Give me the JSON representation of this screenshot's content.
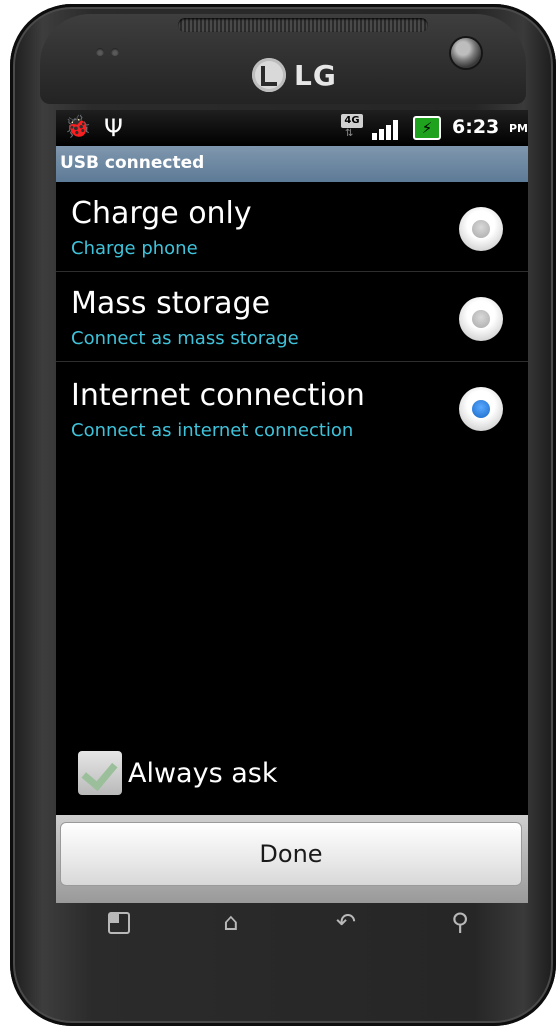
{
  "device": {
    "brand": "LG"
  },
  "status_bar": {
    "network_badge": "4G",
    "time": "6:23",
    "ampm": "PM",
    "icons": [
      "debug-bug-icon",
      "usb-icon",
      "4g-data-icon",
      "signal-icon",
      "battery-charging-icon"
    ]
  },
  "dialog": {
    "title": "USB connected",
    "options": [
      {
        "title": "Charge only",
        "subtitle": "Charge phone",
        "selected": false
      },
      {
        "title": "Mass storage",
        "subtitle": "Connect as mass storage",
        "selected": false
      },
      {
        "title": "Internet connection",
        "subtitle": "Connect as internet connection",
        "selected": true
      }
    ],
    "always_ask": {
      "label": "Always ask",
      "checked": true
    },
    "done_label": "Done"
  },
  "soft_keys": [
    "menu-icon",
    "home-icon",
    "back-icon",
    "search-icon"
  ],
  "colors": {
    "title_bar": "#6f89a3",
    "subtitle_text": "#3fc3db",
    "radio_selected": "#1e73d6",
    "battery": "#1fa31f"
  }
}
